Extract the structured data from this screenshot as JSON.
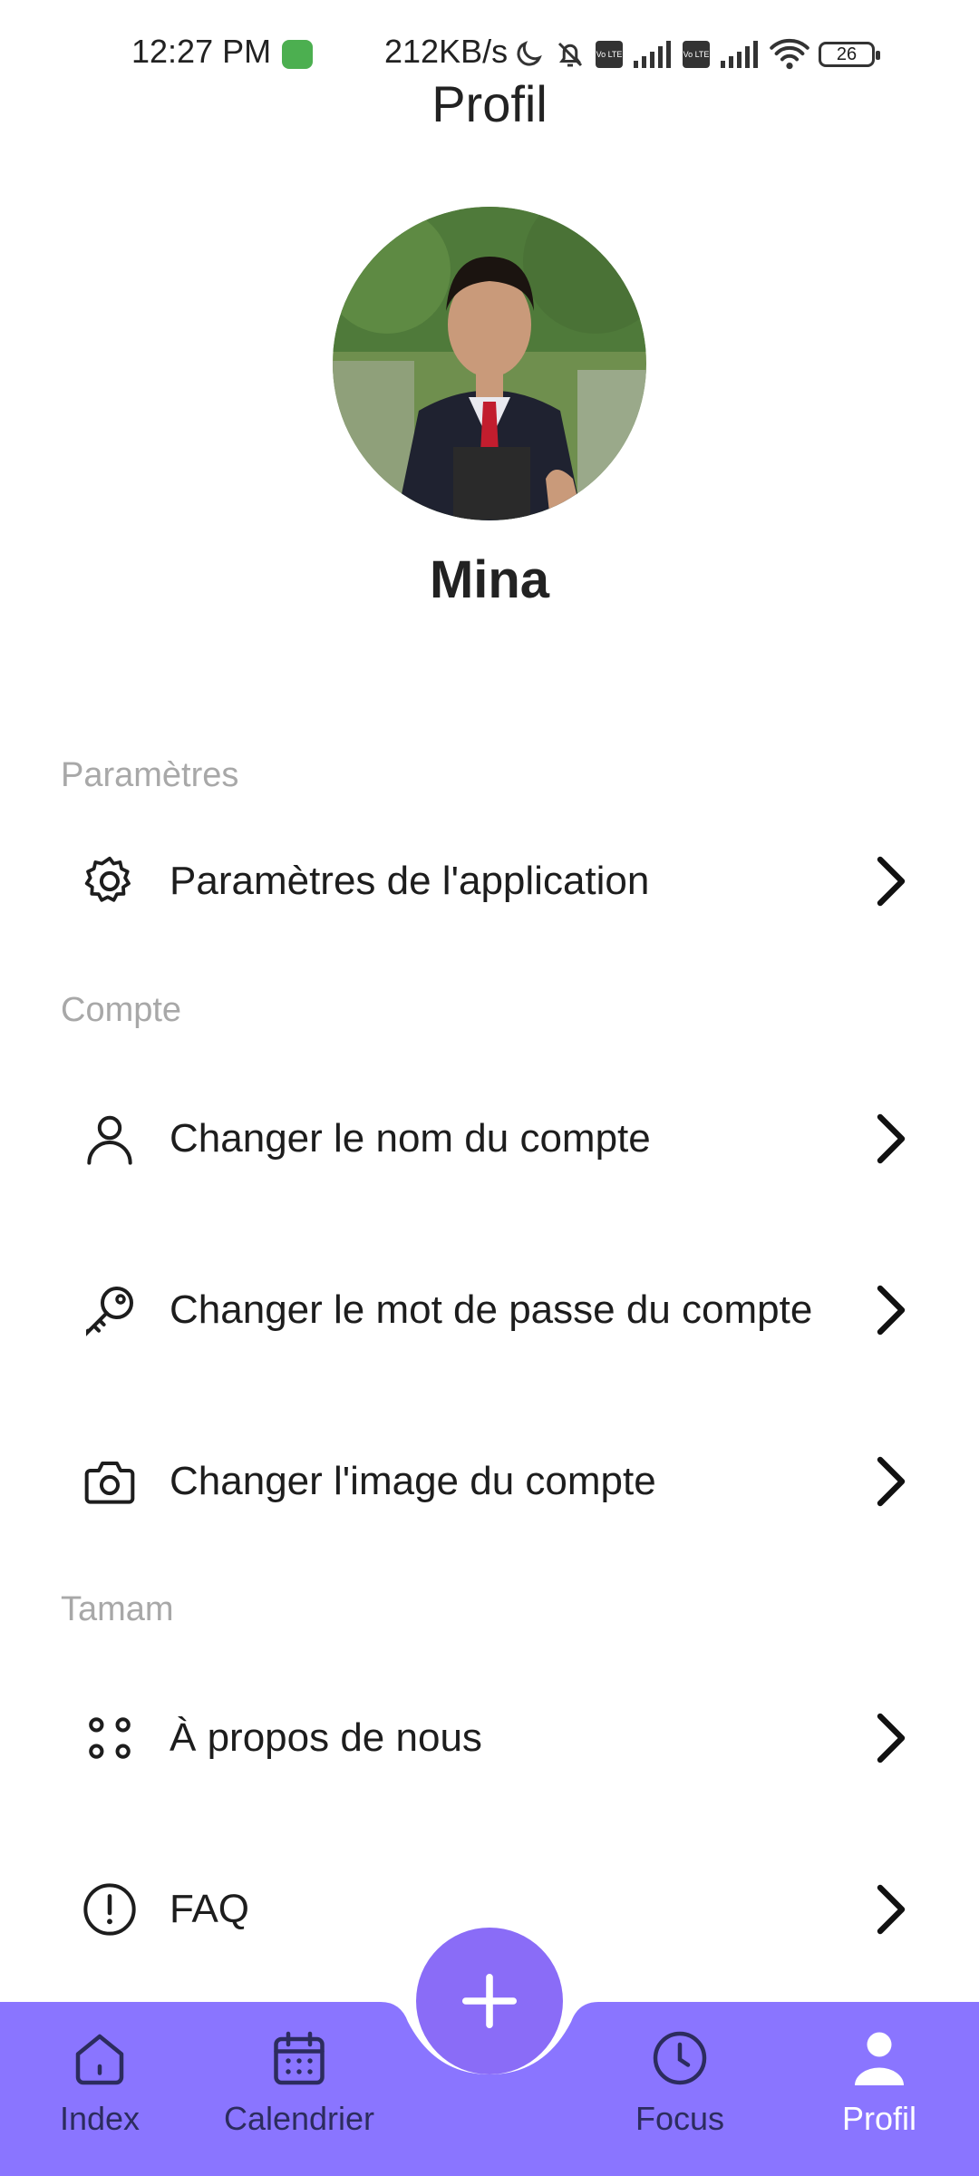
{
  "status_bar": {
    "time": "12:27 PM",
    "speed": "212KB/s",
    "battery": "26",
    "sim_chip_label": "Vo LTE",
    "icons": [
      "moon-icon",
      "bell-off-icon",
      "volte-icon",
      "signal-icon",
      "volte-icon",
      "signal-icon",
      "wifi-icon",
      "battery-icon"
    ]
  },
  "header": {
    "title": "Profil"
  },
  "profile": {
    "name": "Mina"
  },
  "sections": {
    "settings": {
      "title": "Paramètres",
      "items": [
        {
          "label": "Paramètres de l'application",
          "icon": "gear-icon"
        }
      ]
    },
    "account": {
      "title": "Compte",
      "items": [
        {
          "label": "Changer le nom du compte",
          "icon": "user-icon"
        },
        {
          "label": "Changer le mot de passe du compte",
          "icon": "key-icon"
        },
        {
          "label": "Changer l'image du compte",
          "icon": "camera-icon"
        }
      ]
    },
    "misc": {
      "title": "Tamam",
      "items": [
        {
          "label": "À propos de nous",
          "icon": "dots-icon"
        },
        {
          "label": "FAQ",
          "icon": "alert-circle-icon"
        }
      ]
    }
  },
  "bottom_nav": {
    "items": [
      {
        "label": "Index",
        "icon": "home-icon"
      },
      {
        "label": "Calendrier",
        "icon": "calendar-icon"
      },
      {
        "label": "Focus",
        "icon": "clock-icon"
      },
      {
        "label": "Profil",
        "icon": "person-icon",
        "active": true
      }
    ],
    "fab_icon": "plus-icon"
  },
  "colors": {
    "nav_background": "#8a75ff",
    "fab": "#8a6cf7",
    "section_header": "#a8a8a8"
  }
}
